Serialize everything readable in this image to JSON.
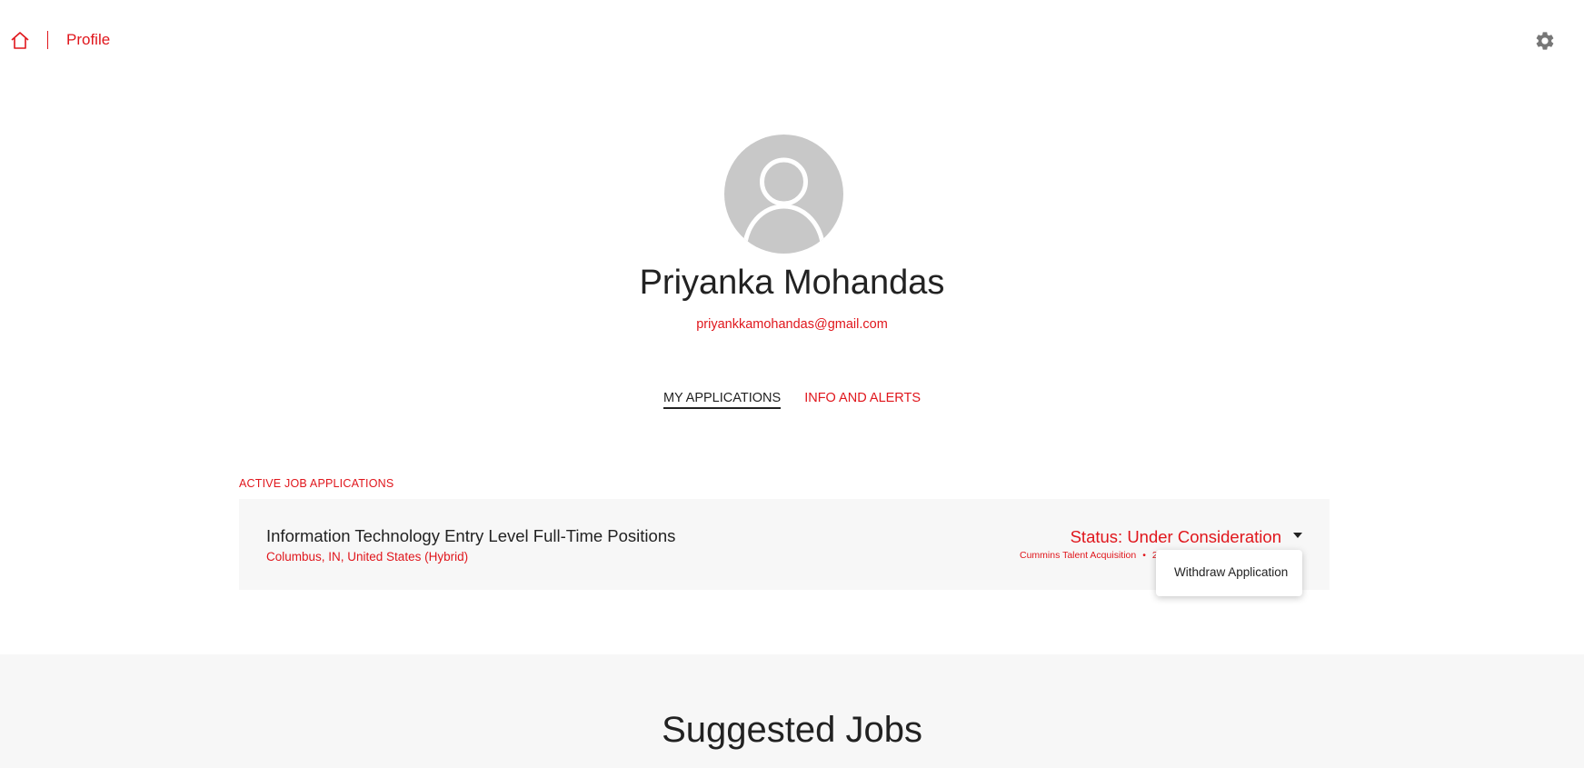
{
  "header": {
    "breadcrumb_label": "Profile",
    "home_icon": "home-icon",
    "settings_icon": "gear-icon"
  },
  "profile": {
    "name": "Priyanka Mohandas",
    "email": "priyankkamohandas@gmail.com",
    "avatar_icon": "user-silhouette-icon"
  },
  "tabs": [
    {
      "label": "MY APPLICATIONS",
      "active": true
    },
    {
      "label": "INFO AND ALERTS",
      "active": false
    }
  ],
  "applications": {
    "section_label": "ACTIVE JOB APPLICATIONS",
    "items": [
      {
        "title": "Information Technology Entry Level Full-Time Positions",
        "location": "Columbus, IN, United States (Hybrid)",
        "status": "Status: Under Consideration",
        "recruiter": "Cummins Talent Acquisition",
        "meta_partial": "2"
      }
    ]
  },
  "dropdown": {
    "items": [
      "Withdraw Application"
    ]
  },
  "suggested": {
    "title": "Suggested Jobs"
  },
  "colors": {
    "accent": "#e0161c",
    "text": "#222222",
    "card_bg": "#f7f7f7",
    "avatar_bg": "#c8c8c8"
  }
}
